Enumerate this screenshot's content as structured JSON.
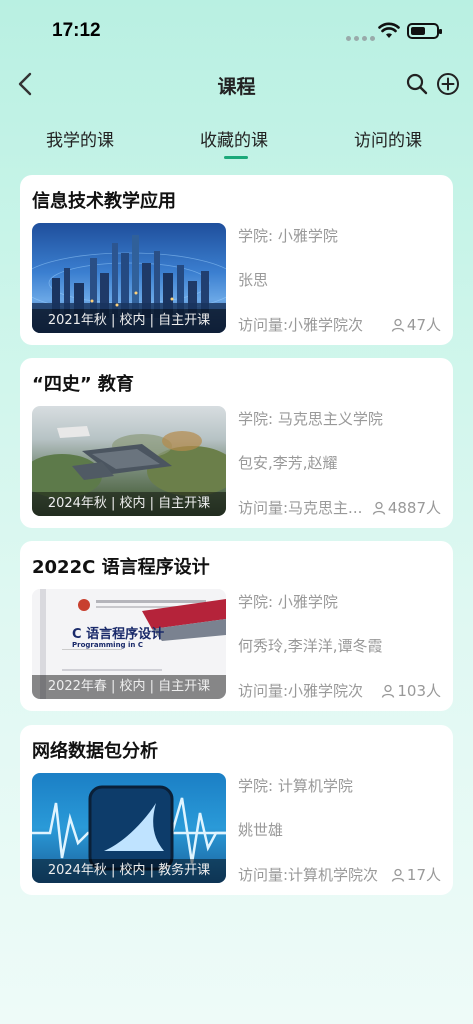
{
  "status": {
    "time": "17:12"
  },
  "nav": {
    "title": "课程"
  },
  "tabs": [
    {
      "label": "我学的课"
    },
    {
      "label": "收藏的课"
    },
    {
      "label": "访问的课"
    }
  ],
  "courses": [
    {
      "title": "信息技术教学应用",
      "caption": "2021年秋 | 校内 | 自主开课",
      "college": "学院: 小雅学院",
      "teachers": "张思",
      "views": "访问量:小雅学院次",
      "visitors": "47人"
    },
    {
      "title": "“四史” 教育",
      "caption": "2024年秋 | 校内 | 自主开课",
      "college": "学院: 马克思主义学院",
      "teachers": "包安,李芳,赵耀",
      "views": "访问量:马克思主...",
      "visitors": "4887人"
    },
    {
      "title": "2022C 语言程序设计",
      "caption": "2022年春 | 校内 | 自主开课",
      "college": "学院: 小雅学院",
      "teachers": "何秀玲,李洋洋,谭冬霞",
      "views": "访问量:小雅学院次",
      "visitors": "103人"
    },
    {
      "title": "网络数据包分析",
      "caption": "2024年秋 | 校内 | 教务开课",
      "college": "学院: 计算机学院",
      "teachers": "姚世雄",
      "views": "访问量:计算机学院次",
      "visitors": "17人"
    }
  ],
  "book_cover": {
    "title": "C 语言程序设计",
    "subtitle": "Programming in C"
  },
  "colors": {
    "accent": "#1ba97a",
    "muted_text": "#999999",
    "card_bg": "#ffffff"
  },
  "icons": [
    "back-icon",
    "search-icon",
    "add-icon",
    "person-icon",
    "wifi-icon",
    "battery-icon"
  ]
}
